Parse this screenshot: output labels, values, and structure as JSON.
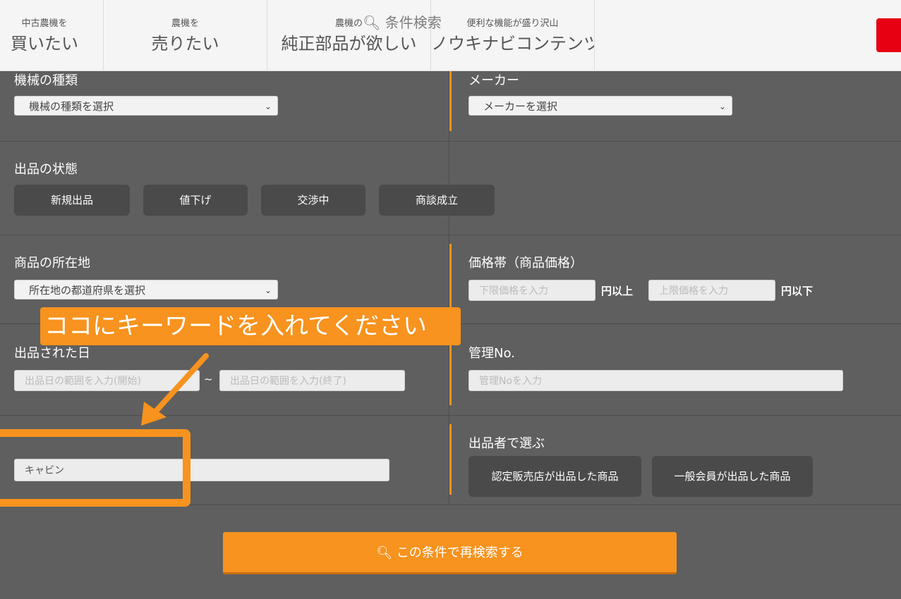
{
  "nav": {
    "items": [
      {
        "small": "中古農機を",
        "big": "買いたい"
      },
      {
        "small": "農機を",
        "big": "売りたい"
      },
      {
        "small": "農機の",
        "big": "純正部品が欲しい"
      },
      {
        "small": "便利な機能が盛り沢山",
        "big": "ノウキナビコンテンツ"
      }
    ],
    "overlay_text": "条件検索"
  },
  "form": {
    "machine_type": {
      "label": "機械の種類",
      "placeholder": "機械の種類を選択"
    },
    "maker": {
      "label": "メーカー",
      "placeholder": "メーカーを選択"
    },
    "status": {
      "label": "出品の状態",
      "options": [
        "新規出品",
        "値下げ",
        "交渉中",
        "商談成立"
      ]
    },
    "location": {
      "label": "商品の所在地",
      "placeholder": "所在地の都道府県を選択"
    },
    "price": {
      "label": "価格帯（商品価格）",
      "min_placeholder": "下限価格を入力",
      "min_suffix": "円以上",
      "max_placeholder": "上限価格を入力",
      "max_suffix": "円以下"
    },
    "listed_date": {
      "label": "出品された日",
      "start_placeholder": "出品日の範囲を入力(開始)",
      "separator": "~",
      "end_placeholder": "出品日の範囲を入力(終了)"
    },
    "management_no": {
      "label": "管理No.",
      "placeholder": "管理Noを入力"
    },
    "keyword": {
      "value": "キャビン"
    },
    "seller": {
      "label": "出品者で選ぶ",
      "options": [
        "認定販売店が出品した商品",
        "一般会員が出品した商品"
      ]
    },
    "search_button": "この条件で再検索する"
  },
  "annotation": {
    "callout_text": "ココにキーワードを入れてください"
  },
  "colors": {
    "accent": "#f7931e",
    "panel": "#5f5f5f",
    "pill": "#4a4a4a",
    "brand_red": "#e60012"
  }
}
